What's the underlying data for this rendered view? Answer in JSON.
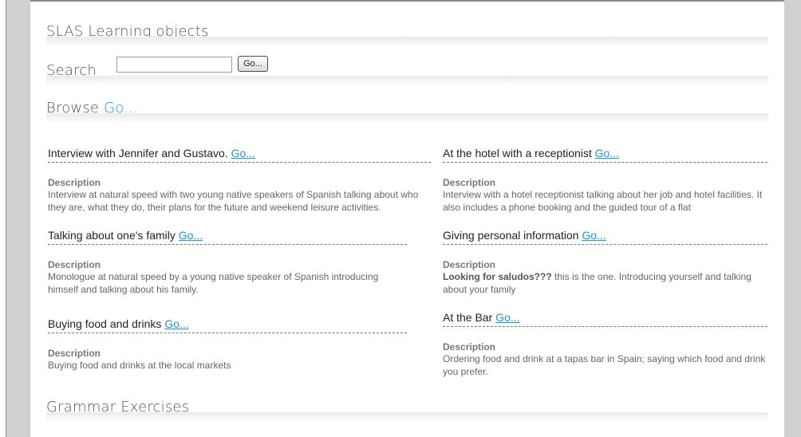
{
  "sections": {
    "learning_objects": "SLAS Learning objects",
    "search_label": "Search",
    "search_value": "",
    "search_button": "Go...",
    "browse_label": "Browse",
    "browse_go": "Go...",
    "grammar": "Grammar Exercises"
  },
  "items": [
    {
      "title": "Interview with Jennifer and Gustavo.",
      "go": "Go...",
      "desc_label": "Description",
      "desc": "Interview at natural speed with two young native speakers of Spanish talking about who they are, what they do, their plans for the future and weekend leisure activities."
    },
    {
      "title": "At the hotel with a receptionist",
      "go": "Go...",
      "desc_label": "Description",
      "desc": "Interview with a hotel receptionist talking about her job and hotel facilities. It also includes a phone booking and the guided tour of a flat"
    },
    {
      "title": "Talking about one's family",
      "go": "Go...",
      "desc_label": "Description",
      "desc": "Monologue at natural speed by a young native speaker of Spanish introducing himself and talking about his family."
    },
    {
      "title": "Giving personal information",
      "go": "Go...",
      "desc_label": "Description",
      "desc_bold": "Looking for saludos???",
      "desc": " this is the one. Introducing yourself and talking about your family"
    },
    {
      "title": "Buying food and drinks",
      "go": "Go...",
      "desc_label": "Description",
      "desc": "Buying food and drinks at the local markets"
    },
    {
      "title": "At the Bar",
      "go": "Go...",
      "desc_label": "Description",
      "desc": "Ordering food and drink at a tapas bar in Spain; saying which food and drink you prefer."
    }
  ]
}
